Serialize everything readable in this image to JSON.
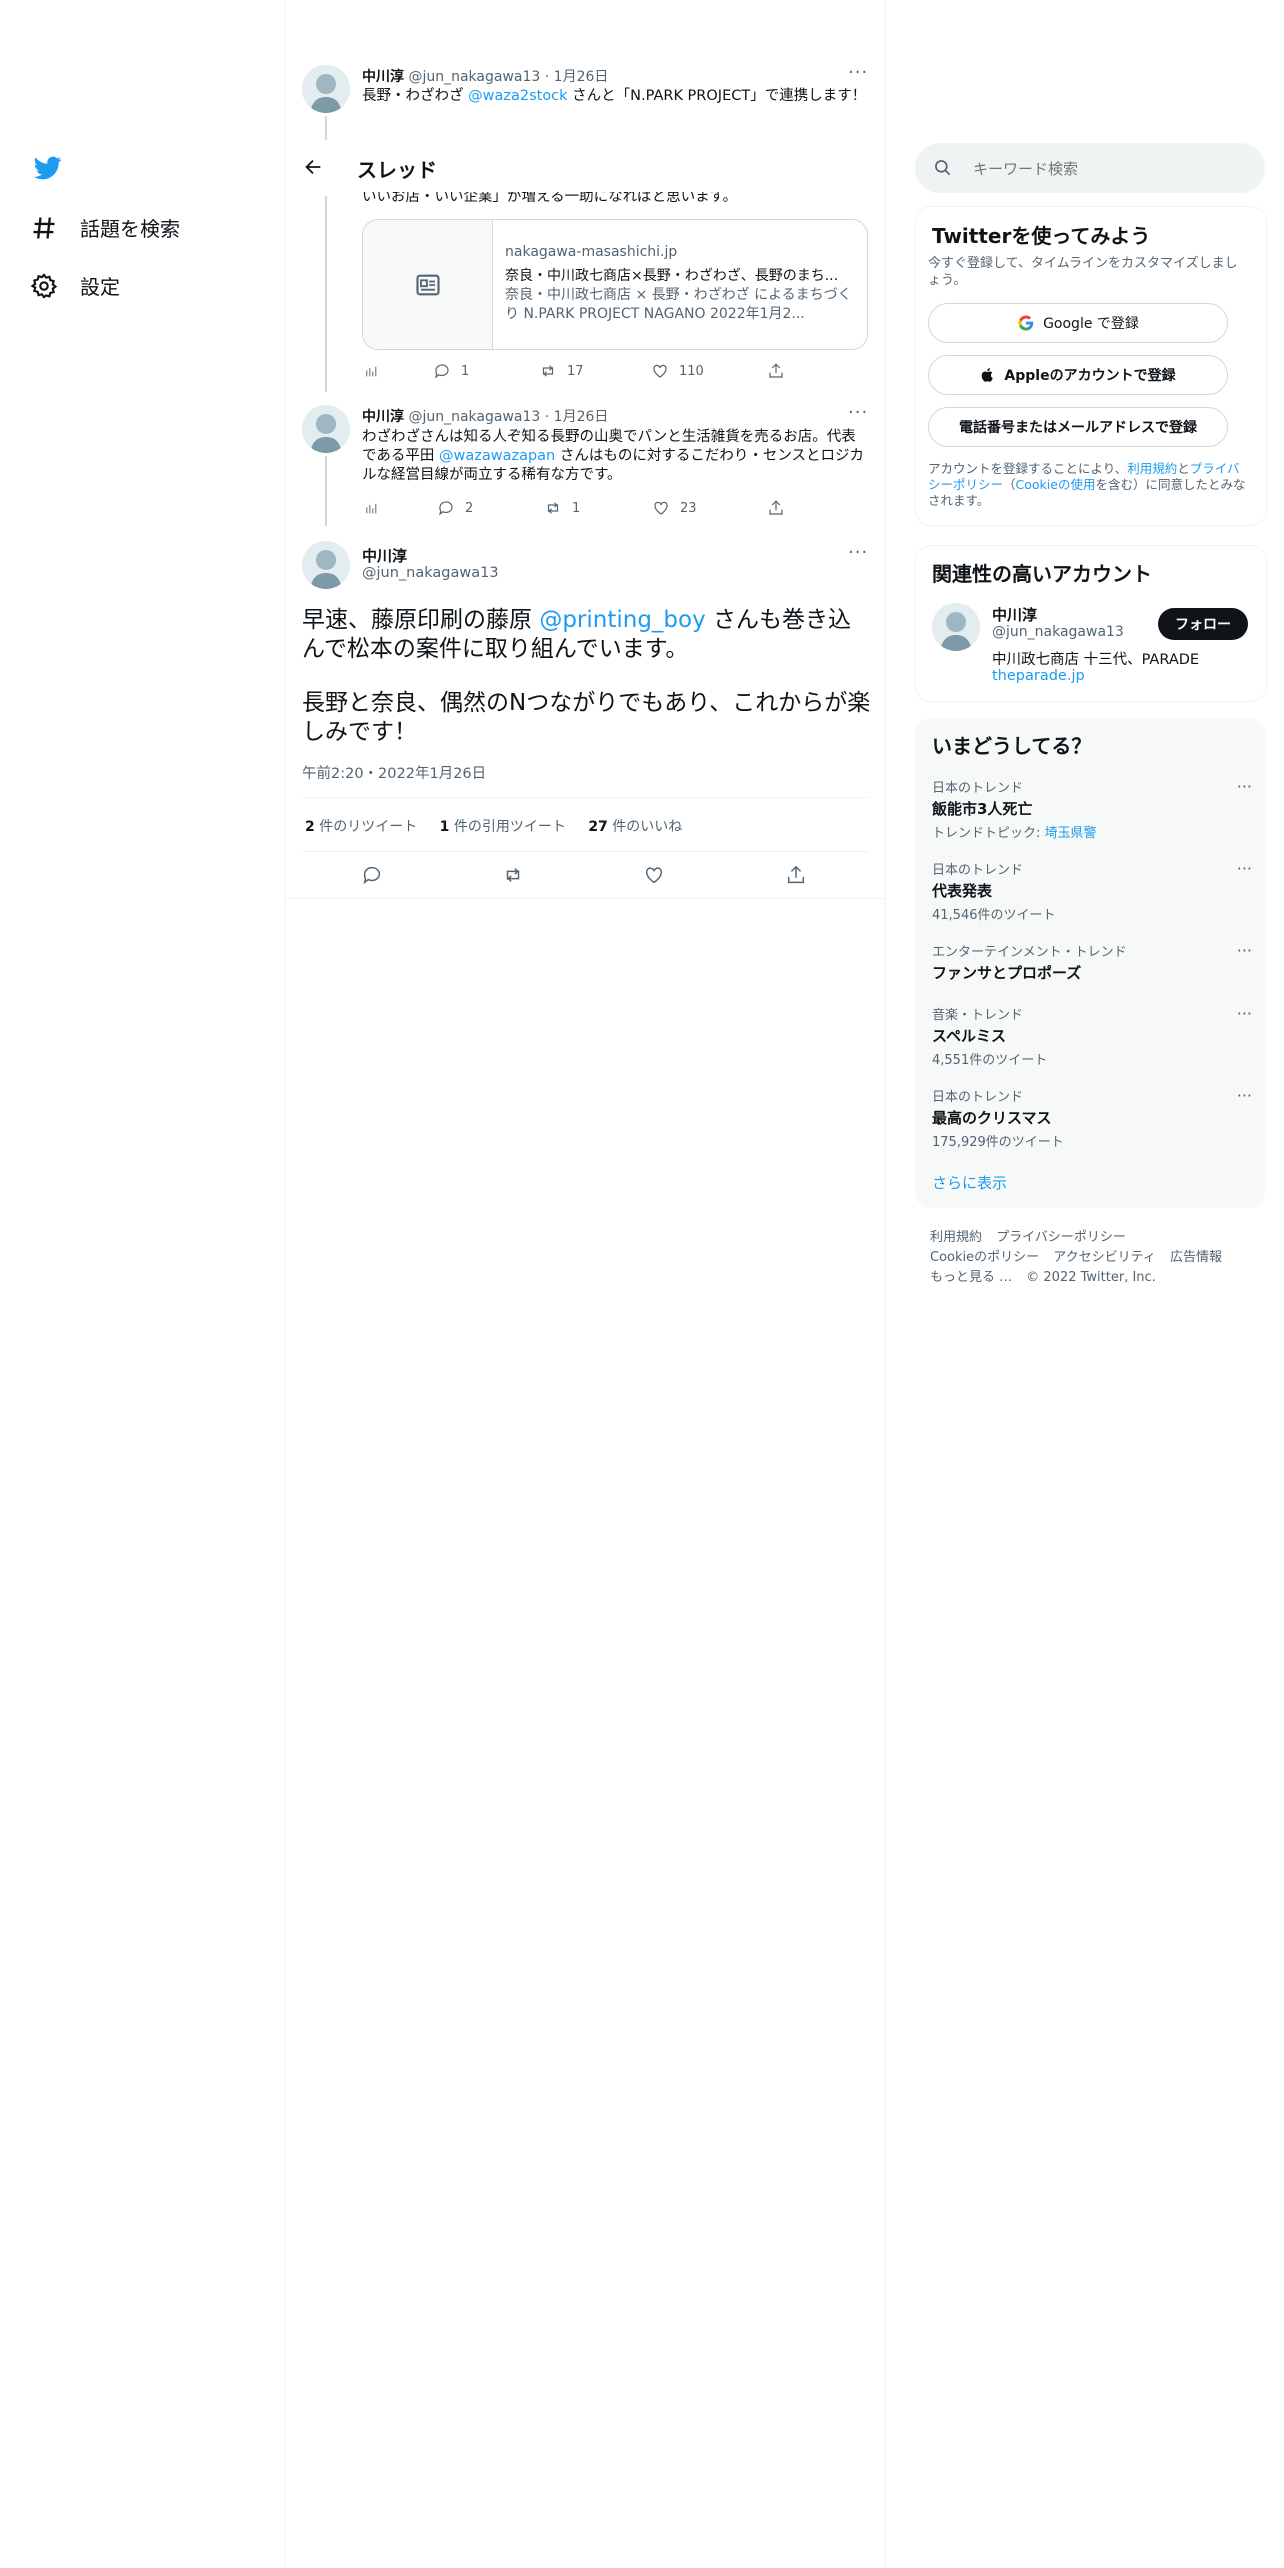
{
  "nav": {
    "explore_label": "話題を検索",
    "settings_label": "設定"
  },
  "header": {
    "title": "スレッド"
  },
  "tweet1": {
    "name": "中川淳",
    "handle": "@jun_nakagawa13",
    "sep": "·",
    "date": "1月26日",
    "text_a": "長野・わざわざ ",
    "mention": "@waza2stock",
    "text_b": " さんと「N.PARK PROJECT」で連携します！",
    "continued": "いいお店・いい企業」が増える一助になればと思います。",
    "card": {
      "domain": "nakagawa-masashichi.jp",
      "title": "奈良・中川政七商店×長野・わざわざ、長野のまち...",
      "desc": "奈良・中川政七商店 × 長野・わざわざ によるまちづくり N.PARK PROJECT NAGANO 2022年1月2..."
    },
    "replies": "1",
    "retweets": "17",
    "likes": "110"
  },
  "tweet2": {
    "name": "中川淳",
    "handle": "@jun_nakagawa13",
    "sep": "·",
    "date": "1月26日",
    "text_a": "わざわざさんは知る人ぞ知る長野の山奥でパンと生活雑貨を売るお店。代表である平田 ",
    "mention": "@wazawazapan",
    "text_b": " さんはものに対するこだわり・センスとロジカルな経営目線が両立する稀有な方です。",
    "replies": "2",
    "retweets": "1",
    "likes": "23"
  },
  "main_tweet": {
    "name": "中川淳",
    "handle": "@jun_nakagawa13",
    "text_a": "早速、藤原印刷の藤原 ",
    "mention": "@printing_boy",
    "text_b": " さんも巻き込んで松本の案件に取り組んでいます。",
    "text_c": "長野と奈良、偶然のNつながりでもあり、これからが楽しみです！",
    "timestamp": "午前2:20・2022年1月26日",
    "retweet_count": "2",
    "retweet_label": " 件のリツイート",
    "quote_count": "1",
    "quote_label": " 件の引用ツイート",
    "like_count": "27",
    "like_label": " 件のいいね"
  },
  "search": {
    "placeholder": "キーワード検索"
  },
  "signup": {
    "title": "Twitterを使ってみよう",
    "subtitle": "今すぐ登録して、タイムラインをカスタマイズしましょう。",
    "google_label": "Google で登録",
    "apple_label": "Appleのアカウントで登録",
    "phone_label": "電話番号またはメールアドレスで登録",
    "legal_a": "アカウントを登録することにより、",
    "legal_link1": "利用規約",
    "legal_b": "と",
    "legal_link2": "プライバシーポリシー",
    "legal_c": "（",
    "legal_link3": "Cookieの使用",
    "legal_d": "を含む）に同意したとみなされます。"
  },
  "related": {
    "title": "関連性の高いアカウント",
    "name": "中川淳",
    "handle": "@jun_nakagawa13",
    "bio": "中川政七商店 十三代、PARADE",
    "link": "theparade.jp",
    "follow_label": "フォロー"
  },
  "trends": {
    "title": "いまどうしてる？",
    "items": [
      {
        "category": "日本のトレンド",
        "name": "飯能市3人死亡",
        "sub_label": "トレンドトピック: ",
        "sub_link": "埼玉県警"
      },
      {
        "category": "日本のトレンド",
        "name": "代表発表",
        "sub": "41,546件のツイート"
      },
      {
        "category": "エンターテインメント・トレンド",
        "name": "ファンサとプロポーズ"
      },
      {
        "category": "音楽・トレンド",
        "name": "スペルミス",
        "sub": "4,551件のツイート"
      },
      {
        "category": "日本のトレンド",
        "name": "最高のクリスマス",
        "sub": "175,929件のツイート"
      }
    ],
    "show_more": "さらに表示"
  },
  "footer": {
    "terms": "利用規約",
    "privacy": "プライバシーポリシー",
    "cookie": "Cookieのポリシー",
    "accessibility": "アクセシビリティ",
    "ads": "広告情報",
    "more": "もっと見る …",
    "copyright": "© 2022 Twitter, Inc."
  },
  "colors": {
    "accent": "#1d9bf0",
    "text": "#0f1419",
    "muted": "#536471"
  }
}
